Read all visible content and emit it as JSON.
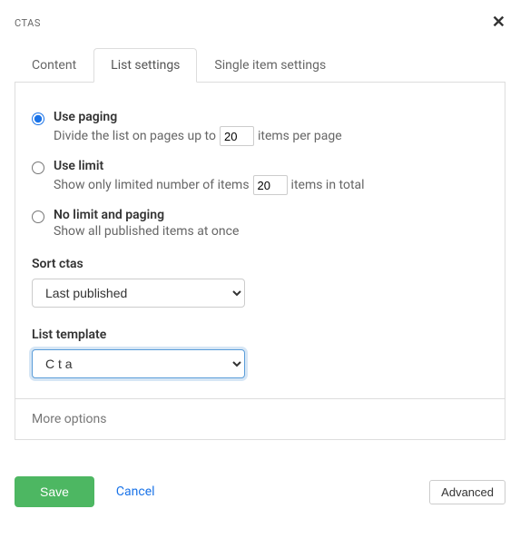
{
  "header": {
    "title": "CTAS"
  },
  "tabs": [
    {
      "label": "Content",
      "active": false
    },
    {
      "label": "List settings",
      "active": true
    },
    {
      "label": "Single item settings",
      "active": false
    }
  ],
  "paging": {
    "usePaging": {
      "label": "Use paging",
      "desc_before": "Divide the list on pages up to",
      "value": "20",
      "desc_after": "items per page",
      "checked": true
    },
    "useLimit": {
      "label": "Use limit",
      "desc_before": "Show only limited number of items",
      "value": "20",
      "desc_after": "items in total",
      "checked": false
    },
    "noLimit": {
      "label": "No limit and paging",
      "desc": "Show all published items at once",
      "checked": false
    }
  },
  "sort": {
    "label": "Sort ctas",
    "value": "Last published"
  },
  "template": {
    "label": "List template",
    "value": "C t a"
  },
  "moreOptions": "More options",
  "footer": {
    "save": "Save",
    "cancel": "Cancel",
    "advanced": "Advanced"
  }
}
